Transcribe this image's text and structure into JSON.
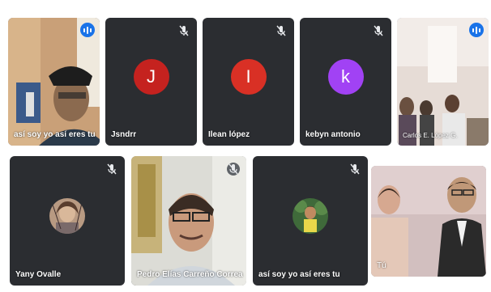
{
  "participants_top": [
    {
      "name": "así soy yo así eres tu",
      "type": "video",
      "speaking": true
    },
    {
      "name": "Jsndrr",
      "type": "avatar",
      "initial": "J",
      "color": "#c5221f",
      "muted": true
    },
    {
      "name": "Ilean lópez",
      "type": "avatar",
      "initial": "I",
      "color": "#d93025",
      "muted": true
    },
    {
      "name": "kebyn antonio",
      "type": "avatar",
      "initial": "k",
      "color": "#a142f4",
      "muted": true
    },
    {
      "name": "Carlos E. López G.",
      "type": "video",
      "speaking": true
    }
  ],
  "participants_bottom": [
    {
      "name": "Yany Ovalle",
      "type": "photo",
      "muted": true
    },
    {
      "name": "Pedro Elías Carreño Correa",
      "type": "video",
      "muted": true
    },
    {
      "name": "así soy yo así eres tu",
      "type": "photo",
      "muted": true
    },
    {
      "name": "Tú",
      "type": "video",
      "muted": false
    }
  ],
  "colors": {
    "tile_bg": "#2b2d31",
    "speaking_outline": "#8ab4f8",
    "speaking_badge": "#1a73e8"
  }
}
